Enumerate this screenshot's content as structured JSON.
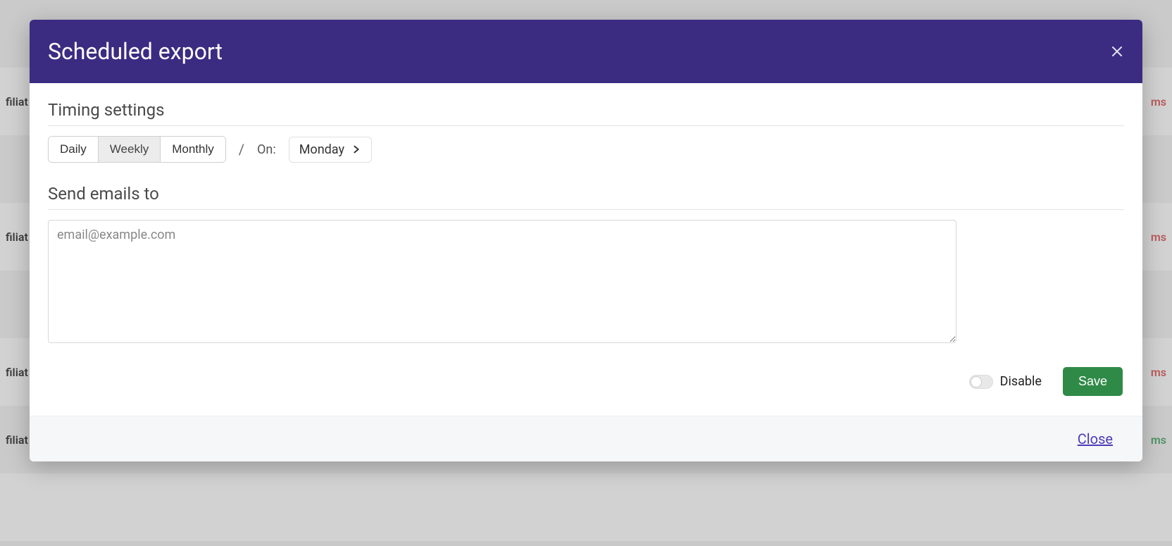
{
  "modal": {
    "title": "Scheduled export",
    "timing": {
      "section_title": "Timing settings",
      "options": {
        "daily": "Daily",
        "weekly": "Weekly",
        "monthly": "Monthly"
      },
      "selected": "weekly",
      "separator": "/",
      "on_label": "On:",
      "day_value": "Monday"
    },
    "emails": {
      "section_title": "Send emails to",
      "placeholder": "email@example.com",
      "value": ""
    },
    "actions": {
      "disable_label": "Disable",
      "save_label": "Save"
    },
    "footer": {
      "close_label": "Close"
    }
  },
  "background": {
    "left_text": "filiat",
    "right_text": "ms"
  }
}
